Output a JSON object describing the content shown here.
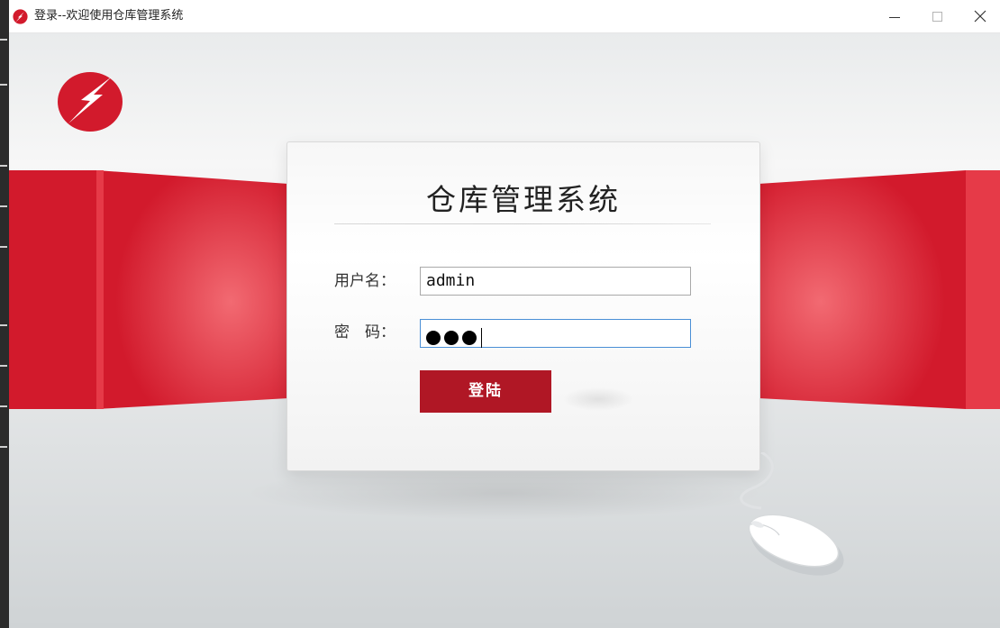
{
  "window": {
    "title": "登录--欢迎使用仓库管理系统",
    "icon": "app-logo-icon",
    "controls": [
      "minimize-icon",
      "maximize-icon",
      "close-icon"
    ]
  },
  "brand": {
    "logo": "brand-logo-icon",
    "accent": "#b01725"
  },
  "login_form": {
    "title": "仓库管理系统",
    "username_label": "用户名：",
    "username_value": "admin",
    "password_label": "密　码：",
    "password_masked_count": 3,
    "login_button": "登陆"
  },
  "colors": {
    "primary_red": "#d21a2c",
    "button_red": "#b01725",
    "focus_border": "#4a8fd6"
  }
}
